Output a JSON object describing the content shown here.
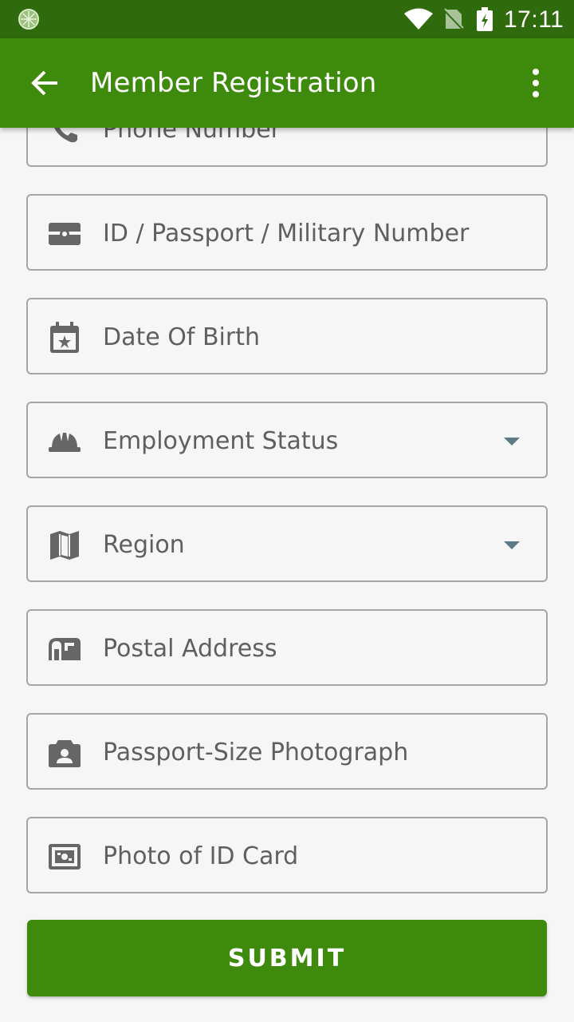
{
  "status_bar": {
    "time": "17:11"
  },
  "app_bar": {
    "title": "Member Registration"
  },
  "form": {
    "fields": [
      {
        "label": "Phone Number",
        "icon": "phone-icon"
      },
      {
        "label": "ID / Passport / Military Number",
        "icon": "id-card-icon"
      },
      {
        "label": "Date Of Birth",
        "icon": "calendar-icon"
      },
      {
        "label": "Employment Status",
        "icon": "hard-hat-icon",
        "dropdown": true
      },
      {
        "label": "Region",
        "icon": "map-icon",
        "dropdown": true
      },
      {
        "label": "Postal Address",
        "icon": "mailbox-icon"
      },
      {
        "label": "Passport-Size Photograph",
        "icon": "camera-icon"
      },
      {
        "label": "Photo of ID Card",
        "icon": "picture-card-icon"
      }
    ],
    "submit_label": "SUBMIT"
  },
  "colors": {
    "status_bar": "#2f6b0d",
    "app_bar": "#3e8a0c",
    "icon": "#666666",
    "caret": "#5d7a86"
  }
}
